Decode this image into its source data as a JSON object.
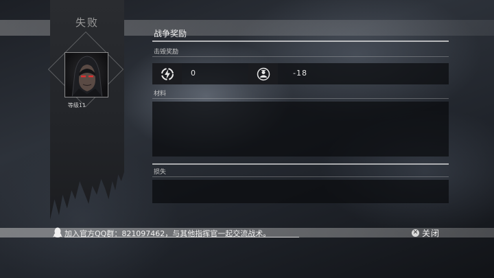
{
  "banner": {
    "title": "失败",
    "level": "等级11"
  },
  "panel": {
    "title": "战争奖励",
    "sections": {
      "destroy_reward": "击毁奖励",
      "materials": "材料",
      "loss": "损失"
    },
    "rewards": [
      {
        "icon": "energy-bolt-icon",
        "value": "0"
      },
      {
        "icon": "commander-rank-icon",
        "value": "-18"
      }
    ]
  },
  "footer": {
    "qq_group_text": "加入官方QQ群：821097462，与其他指挥官一起交流战术。",
    "close_label": "关闭"
  }
}
